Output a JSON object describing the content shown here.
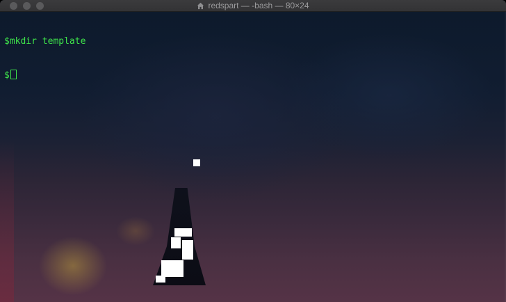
{
  "window": {
    "title": "redspart — -bash — 80×24",
    "title_icon": "home-icon"
  },
  "terminal": {
    "lines": [
      {
        "prompt": "$",
        "command": "mkdir template"
      },
      {
        "prompt": "$",
        "command": ""
      }
    ],
    "text_color": "#3ee24a"
  },
  "colors": {
    "titlebar": "#38383a",
    "background_top": "#0d1a2c",
    "background_bottom": "#553346"
  }
}
